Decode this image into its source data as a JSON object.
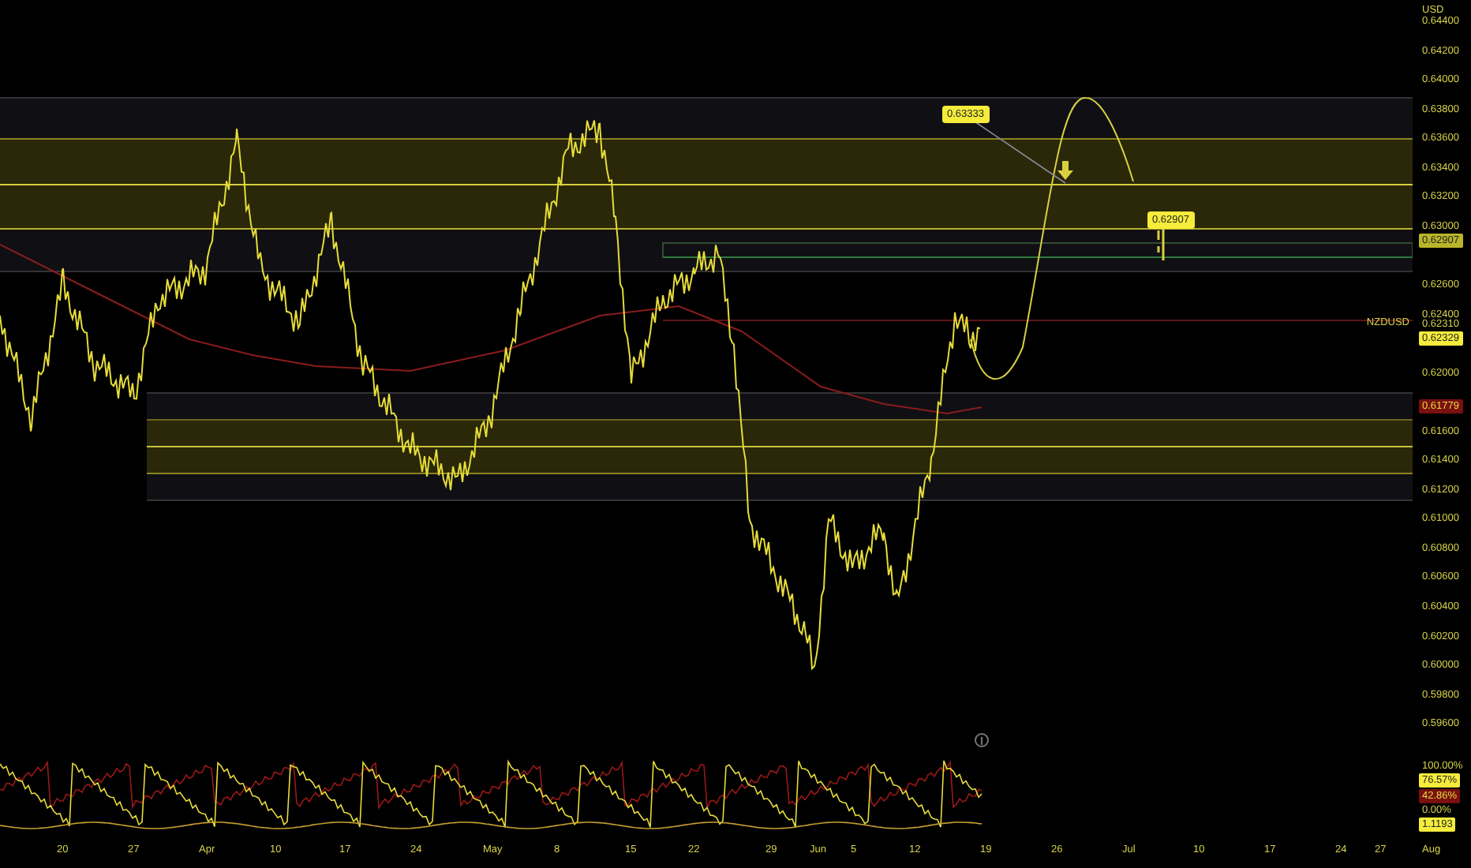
{
  "price_axis": {
    "currency": "USD",
    "ticks": [
      "0.64400",
      "0.64200",
      "0.64000",
      "0.63800",
      "0.63600",
      "0.63400",
      "0.63200",
      "0.63000",
      "0.62600",
      "0.62400",
      "0.62000",
      "0.61600",
      "0.61400",
      "0.61200",
      "0.61000",
      "0.60800",
      "0.60600",
      "0.60400",
      "0.60200",
      "0.60000",
      "0.59800",
      "0.59600"
    ],
    "tags": [
      {
        "text": "0.62907",
        "color": "#b9b52a"
      },
      {
        "text": "0.62329",
        "color": "#f5ec3c"
      },
      {
        "text": "0.61779",
        "color": "#7a1010"
      }
    ]
  },
  "symbol_label": "NZDUSD",
  "symbol_price": "0.62310",
  "annotations": [
    {
      "text": "0.63333"
    },
    {
      "text": "0.62907"
    }
  ],
  "indicator": {
    "scale": [
      "100.00%",
      "0.00%"
    ],
    "tags": [
      {
        "text": "76.57%",
        "color": "#f5ec3c"
      },
      {
        "text": "42.86%",
        "color": "#7a1010"
      },
      {
        "text": "1.1193",
        "color": "#f5ec3c"
      }
    ]
  },
  "dates": [
    "20",
    "27",
    "Apr",
    "10",
    "17",
    "24",
    "May",
    "8",
    "15",
    "22",
    "29",
    "Jun",
    "5",
    "12",
    "19",
    "26",
    "Jul",
    "10",
    "17",
    "24",
    "27",
    "Aug"
  ]
}
